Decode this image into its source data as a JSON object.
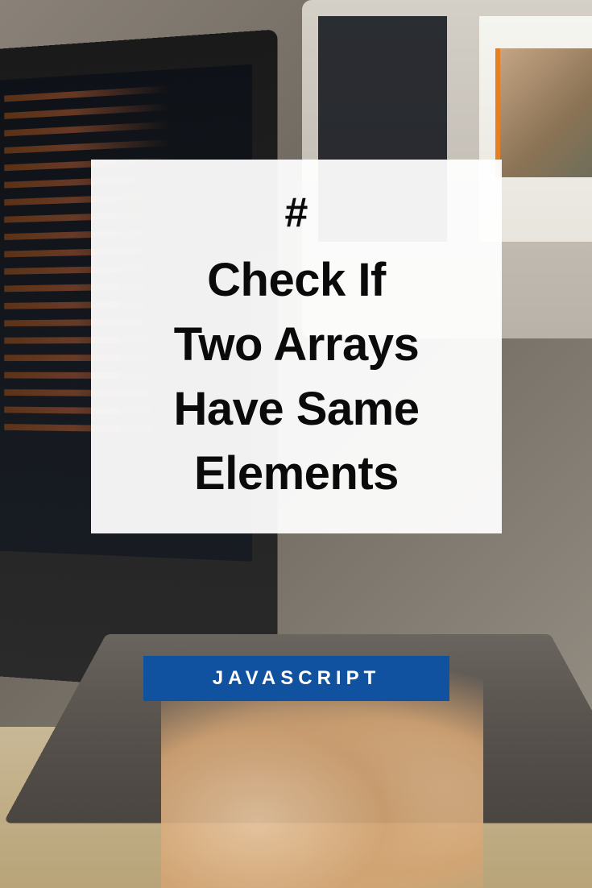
{
  "card": {
    "hash": "#",
    "title_line1": "Check If",
    "title_line2": "Two Arrays",
    "title_line3": "Have Same",
    "title_line4": "Elements"
  },
  "badge": {
    "label": "JAVASCRIPT"
  }
}
